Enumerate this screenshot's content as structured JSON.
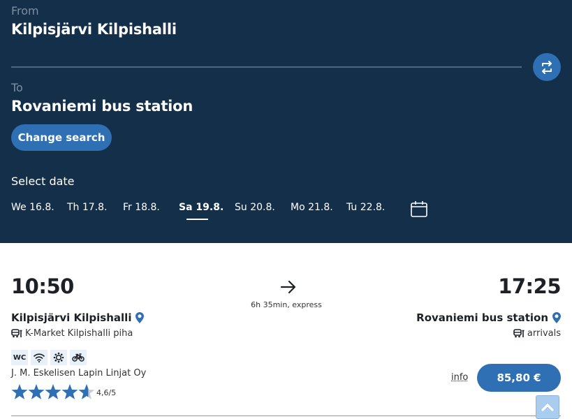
{
  "search": {
    "from_label": "From",
    "from_value": "Kilpisjärvi Kilpishalli",
    "to_label": "To",
    "to_value": "Rovaniemi bus station",
    "swap_icon": "swap-arrows-icon",
    "change_search_label": "Change search"
  },
  "dates": {
    "label": "Select date",
    "items": [
      {
        "label": "We 16.8.",
        "active": false
      },
      {
        "label": "Th 17.8.",
        "active": false
      },
      {
        "label": "Fr 18.8.",
        "active": false
      },
      {
        "label": "Sa 19.8.",
        "active": true
      },
      {
        "label": "Su 20.8.",
        "active": false
      },
      {
        "label": "Mo 21.8.",
        "active": false
      },
      {
        "label": "Tu 22.8.",
        "active": false
      }
    ],
    "calendar_icon": "calendar-icon"
  },
  "trip": {
    "departure_time": "10:50",
    "arrival_time": "17:25",
    "duration": "6h 35min, express",
    "departure_stop": "Kilpisjärvi Kilpishalli",
    "departure_platform": "K-Market Kilpishalli piha",
    "arrival_stop": "Rovaniemi bus station",
    "arrival_platform": "arrivals",
    "amenities": [
      {
        "name": "wc",
        "label": "WC"
      },
      {
        "name": "wifi",
        "label": ""
      },
      {
        "name": "air-conditioning",
        "label": ""
      },
      {
        "name": "bicycle",
        "label": ""
      }
    ],
    "operator": "J. M. Eskelisen Lapin Linjat Oy",
    "rating": 4.6,
    "rating_max": 5,
    "rating_text": "4,6/5",
    "info_label": "info",
    "price": "85,80 €"
  },
  "colors": {
    "header_bg": "#142f4a",
    "accent": "#2f6fb3",
    "star": "#2f6fb3"
  }
}
